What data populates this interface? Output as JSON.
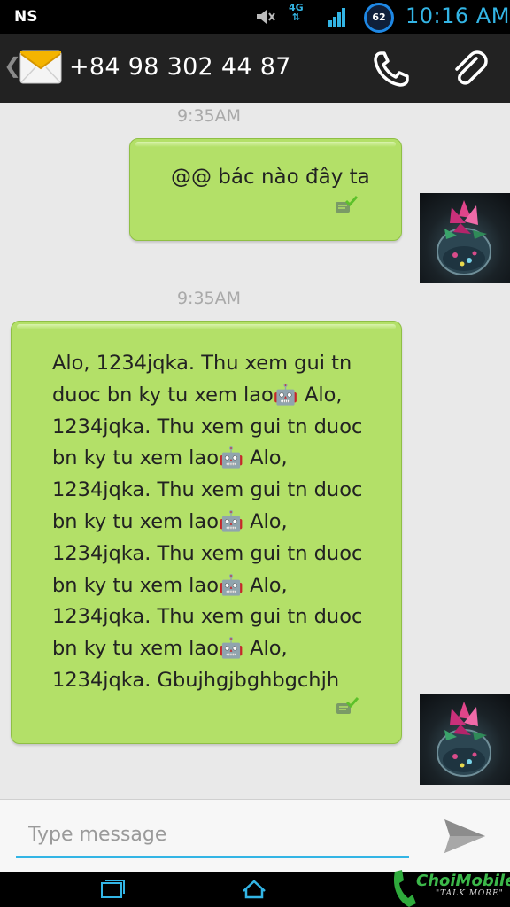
{
  "status_bar": {
    "carrier": "NS",
    "network": "4G",
    "battery_level": "62",
    "time": "10:16 AM"
  },
  "header": {
    "back_icon": "chevron-left-icon",
    "app_icon": "envelope-icon",
    "contact": "+84 98 302 44 87",
    "call_icon": "phone-icon",
    "attach_icon": "paperclip-icon"
  },
  "conversation": {
    "messages": [
      {
        "timestamp": "9:35AM",
        "text": "@@ bác nào đây ta",
        "status_icon": "delivered-check-icon"
      },
      {
        "timestamp": "9:35AM",
        "text": "Alo, 1234jqka. Thu xem gui tn duoc bn ky tu xem lao🤖 Alo, 1234jqka. Thu xem gui tn duoc bn ky tu xem lao🤖 Alo, 1234jqka. Thu xem gui tn duoc bn ky tu xem lao🤖 Alo, 1234jqka. Thu xem gui tn duoc bn ky tu xem lao🤖 Alo, 1234jqka. Thu xem gui tn duoc bn ky tu xem lao🤖 Alo, 1234jqka. Gbujhgjbghbgchjh",
        "status_icon": "delivered-check-icon"
      }
    ]
  },
  "compose": {
    "placeholder": "Type message",
    "value": "",
    "send_icon": "send-icon"
  },
  "nav_bar": {
    "recent_icon": "recent-apps-icon",
    "home_icon": "home-icon"
  },
  "watermark": {
    "text": "ChoiMobile",
    "tagline": "\"TALK MORE\""
  },
  "colors": {
    "accent": "#33b5e5",
    "bubble": "#b3e068",
    "background": "#e9e9e9",
    "action_bar": "#222222"
  }
}
